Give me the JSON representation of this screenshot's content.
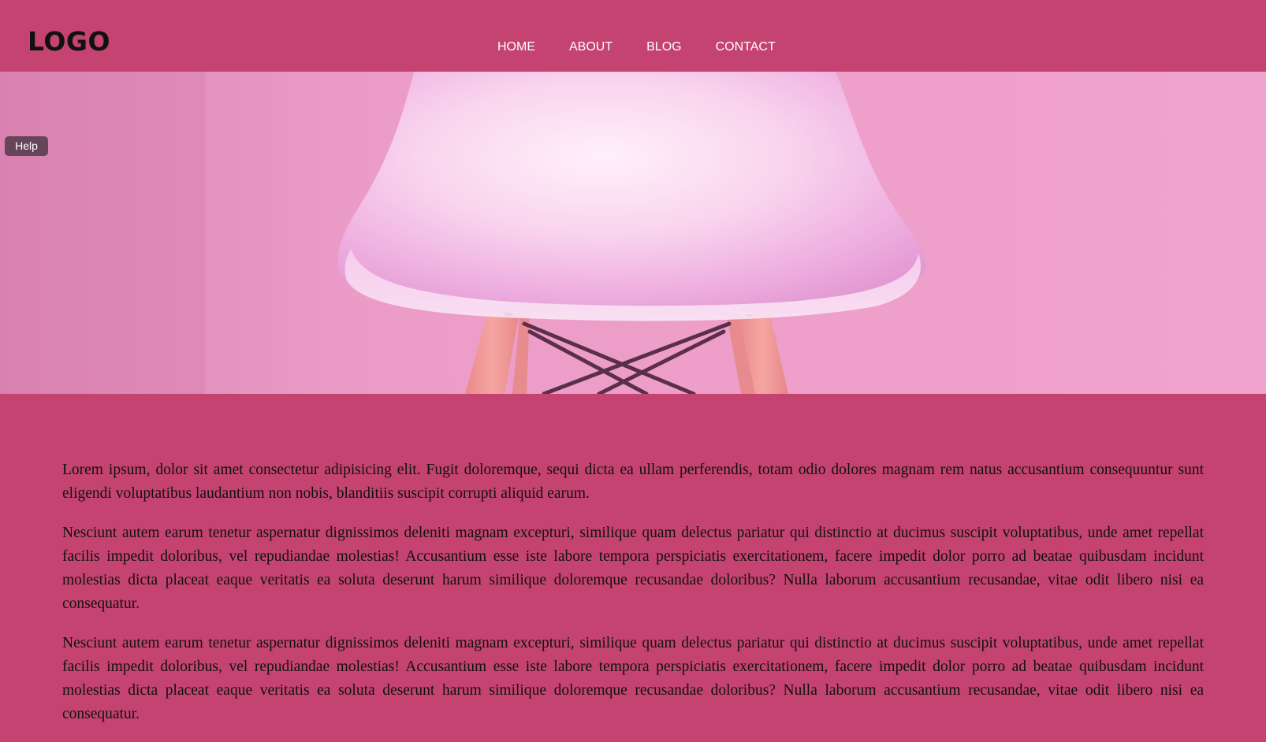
{
  "header": {
    "logo": "LOGO",
    "nav": [
      {
        "label": "HOME"
      },
      {
        "label": "ABOUT"
      },
      {
        "label": "BLOG"
      },
      {
        "label": "CONTACT"
      }
    ]
  },
  "hero": {
    "image": "pink-chair-photo"
  },
  "help": {
    "label": "Help"
  },
  "content": {
    "paragraphs": [
      "Lorem ipsum, dolor sit amet consectetur adipisicing elit. Fugit doloremque, sequi dicta ea ullam perferendis, totam odio dolores magnam rem natus accusantium consequuntur sunt eligendi voluptatibus laudantium non nobis, blanditiis suscipit corrupti aliquid earum.",
      "Nesciunt autem earum tenetur aspernatur dignissimos deleniti magnam excepturi, similique quam delectus pariatur qui distinctio at ducimus suscipit voluptatibus, unde amet repellat facilis impedit doloribus, vel repudiandae molestias! Accusantium esse iste labore tempora perspiciatis exercitationem, facere impedit dolor porro ad beatae quibusdam incidunt molestias dicta placeat eaque veritatis ea soluta deserunt harum similique doloremque recusandae doloribus? Nulla laborum accusantium recusandae, vitae odit libero nisi ea consequatur.",
      "Nesciunt autem earum tenetur aspernatur dignissimos deleniti magnam excepturi, similique quam delectus pariatur qui distinctio at ducimus suscipit voluptatibus, unde amet repellat facilis impedit doloribus, vel repudiandae molestias! Accusantium esse iste labore tempora perspiciatis exercitationem, facere impedit dolor porro ad beatae quibusdam incidunt molestias dicta placeat eaque veritatis ea soluta deserunt harum similique doloremque recusandae doloribus? Nulla laborum accusantium recusandae, vitae odit libero nisi ea consequatur."
    ]
  },
  "colors": {
    "header_bg": "#c44370",
    "page_bg": "#c44370",
    "hero_wall": "#e892be",
    "text": "#111111",
    "nav_text": "#ffffff"
  }
}
